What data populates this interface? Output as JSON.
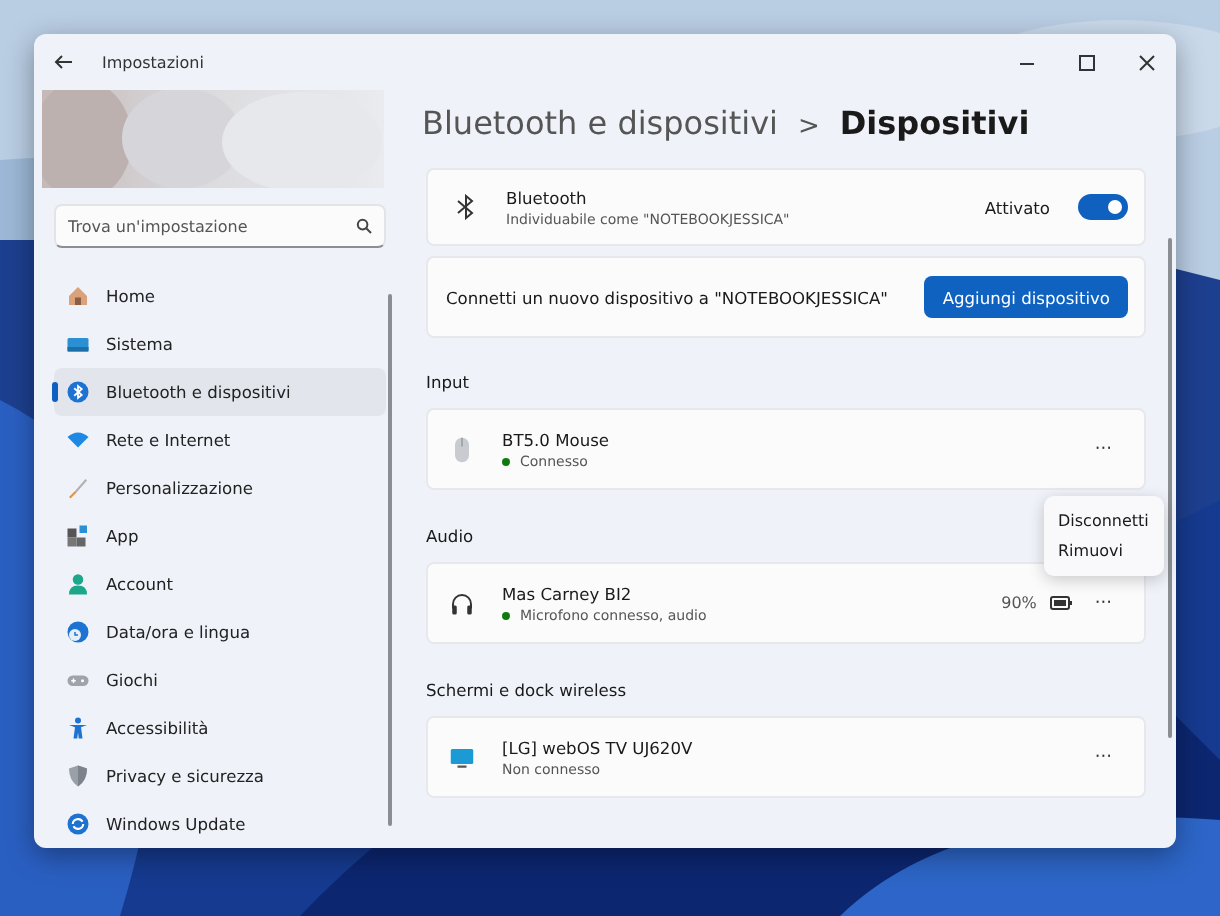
{
  "window": {
    "title": "Impostazioni"
  },
  "sidebar": {
    "search": {
      "placeholder": "Trova un'impostazione"
    },
    "items": [
      {
        "label": "Home",
        "kind": "home",
        "selected": false
      },
      {
        "label": "Sistema",
        "kind": "system",
        "selected": false
      },
      {
        "label": "Bluetooth e dispositivi",
        "kind": "bluetooth",
        "selected": true
      },
      {
        "label": "Rete e Internet",
        "kind": "wifi",
        "selected": false
      },
      {
        "label": "Personalizzazione",
        "kind": "brush",
        "selected": false
      },
      {
        "label": "App",
        "kind": "apps",
        "selected": false
      },
      {
        "label": "Account",
        "kind": "person",
        "selected": false
      },
      {
        "label": "Data/ora e lingua",
        "kind": "clock",
        "selected": false
      },
      {
        "label": "Giochi",
        "kind": "gamepad",
        "selected": false
      },
      {
        "label": "Accessibilità",
        "kind": "accessibility",
        "selected": false
      },
      {
        "label": "Privacy e sicurezza",
        "kind": "shield",
        "selected": false
      },
      {
        "label": "Windows Update",
        "kind": "update",
        "selected": false
      }
    ]
  },
  "breadcrumb": {
    "parent": "Bluetooth e dispositivi",
    "separator": ">",
    "current": "Dispositivi"
  },
  "bluetooth": {
    "title": "Bluetooth",
    "subtitle": "Individuabile come \"NOTEBOOKJESSICA\"",
    "state_label": "Attivato",
    "on": true
  },
  "add_device": {
    "text": "Connetti un nuovo dispositivo a \"NOTEBOOKJESSICA\"",
    "button": "Aggiungi dispositivo"
  },
  "sections": [
    {
      "heading": "Input",
      "devices": [
        {
          "kind": "mouse",
          "name": "BT5.0 Mouse",
          "status": "Connesso",
          "connected": true,
          "more": "···"
        }
      ]
    },
    {
      "heading": "Audio",
      "devices": [
        {
          "kind": "headphones",
          "name": "Mas Carney BI2",
          "status": "Microfono connesso, audio",
          "connected": true,
          "battery": "90%",
          "more": "···"
        }
      ]
    },
    {
      "heading": "Schermi e dock wireless",
      "devices": [
        {
          "kind": "monitor",
          "name": "[LG] webOS TV UJ620V",
          "status": "Non connesso",
          "connected": false,
          "more": "···"
        }
      ]
    }
  ],
  "context_menu": {
    "items": [
      "Disconnetti",
      "Rimuovi"
    ]
  }
}
